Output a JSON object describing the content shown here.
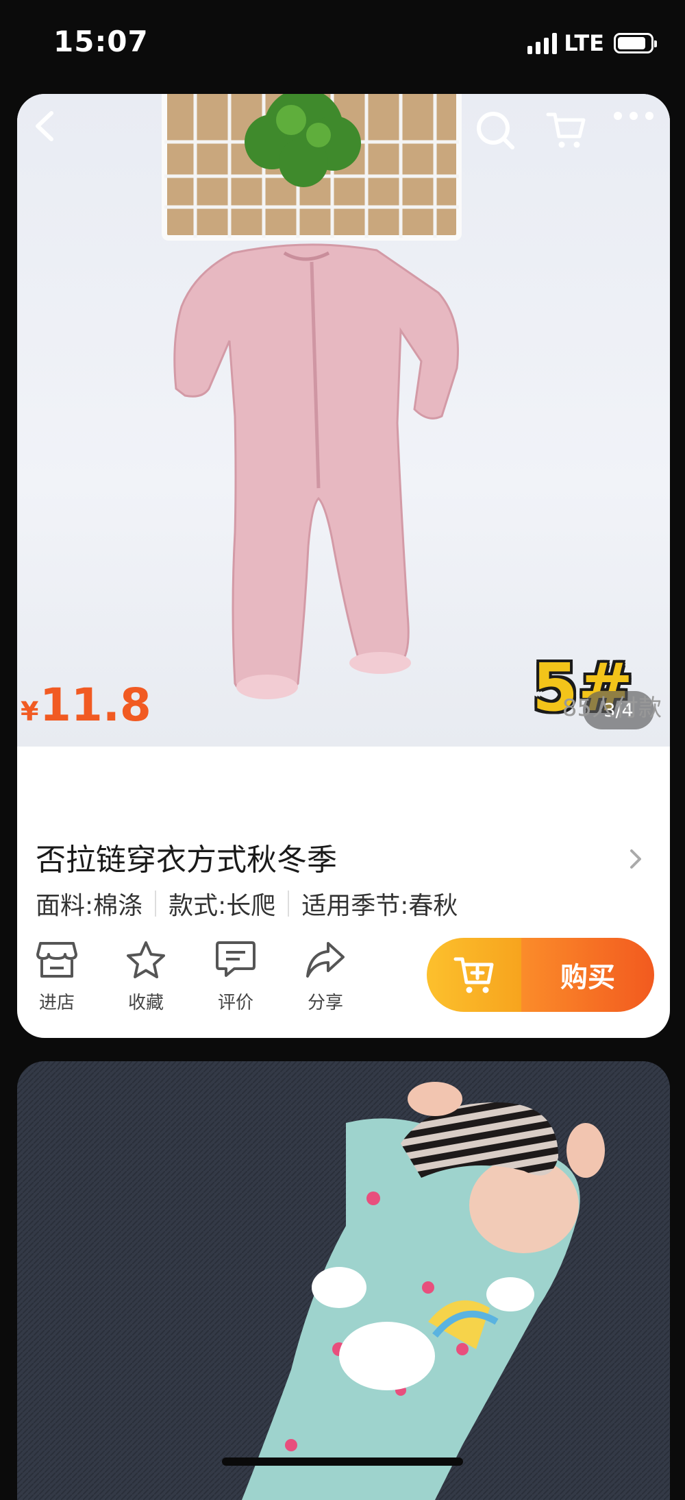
{
  "status_bar": {
    "time": "15:07",
    "network": "LTE"
  },
  "gallery": {
    "watermark": "5#",
    "page_indicator": "3/4"
  },
  "product": {
    "currency_symbol": "¥",
    "price": "11.8",
    "sales": "85人付款",
    "title": "否拉链穿衣方式秋冬季",
    "attributes": [
      "面料:棉涤",
      "款式:长爬",
      "适用季节:春秋"
    ]
  },
  "actions": [
    {
      "label": "进店",
      "icon": "store-icon"
    },
    {
      "label": "收藏",
      "icon": "star-icon"
    },
    {
      "label": "评价",
      "icon": "comment-icon"
    },
    {
      "label": "分享",
      "icon": "share-icon"
    }
  ],
  "buy": {
    "add_cart_icon": "cart-plus-icon",
    "buy_label": "购买"
  },
  "colors": {
    "accent": "#f15a22",
    "add_cart": "#f9b326",
    "buy": "#f36a21"
  }
}
